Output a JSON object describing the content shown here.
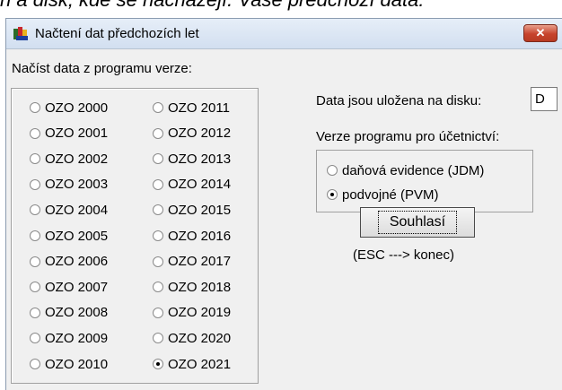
{
  "top_cut_text": "n a disk, kde se nacházejí. Vaše předchozí data:",
  "window": {
    "title": "Načtení dat předchozích let",
    "close_symbol": "✕"
  },
  "left_group": {
    "label": "Načíst data z programu verze:",
    "items": [
      {
        "label": "OZO 2000",
        "checked": false
      },
      {
        "label": "OZO 2001",
        "checked": false
      },
      {
        "label": "OZO 2002",
        "checked": false
      },
      {
        "label": "OZO 2003",
        "checked": false
      },
      {
        "label": "OZO 2004",
        "checked": false
      },
      {
        "label": "OZO 2005",
        "checked": false
      },
      {
        "label": "OZO 2006",
        "checked": false
      },
      {
        "label": "OZO 2007",
        "checked": false
      },
      {
        "label": "OZO 2008",
        "checked": false
      },
      {
        "label": "OZO 2009",
        "checked": false
      },
      {
        "label": "OZO 2010",
        "checked": false
      },
      {
        "label": "OZO 2011",
        "checked": false
      },
      {
        "label": "OZO 2012",
        "checked": false
      },
      {
        "label": "OZO 2013",
        "checked": false
      },
      {
        "label": "OZO 2014",
        "checked": false
      },
      {
        "label": "OZO 2015",
        "checked": false
      },
      {
        "label": "OZO 2016",
        "checked": false
      },
      {
        "label": "OZO 2017",
        "checked": false
      },
      {
        "label": "OZO 2018",
        "checked": false
      },
      {
        "label": "OZO 2019",
        "checked": false
      },
      {
        "label": "OZO 2020",
        "checked": false
      },
      {
        "label": "OZO 2021",
        "checked": true
      }
    ]
  },
  "disk": {
    "label": "Data jsou uložena na disku:",
    "value": "D"
  },
  "accounting": {
    "label": "Verze programu pro účetnictví:",
    "options": [
      {
        "label": "daňová evidence (JDM)",
        "checked": false
      },
      {
        "label": "podvojné (PVM)",
        "checked": true
      }
    ]
  },
  "confirm": {
    "button_label": "Souhlasí",
    "hint": "(ESC ---> konec)"
  }
}
